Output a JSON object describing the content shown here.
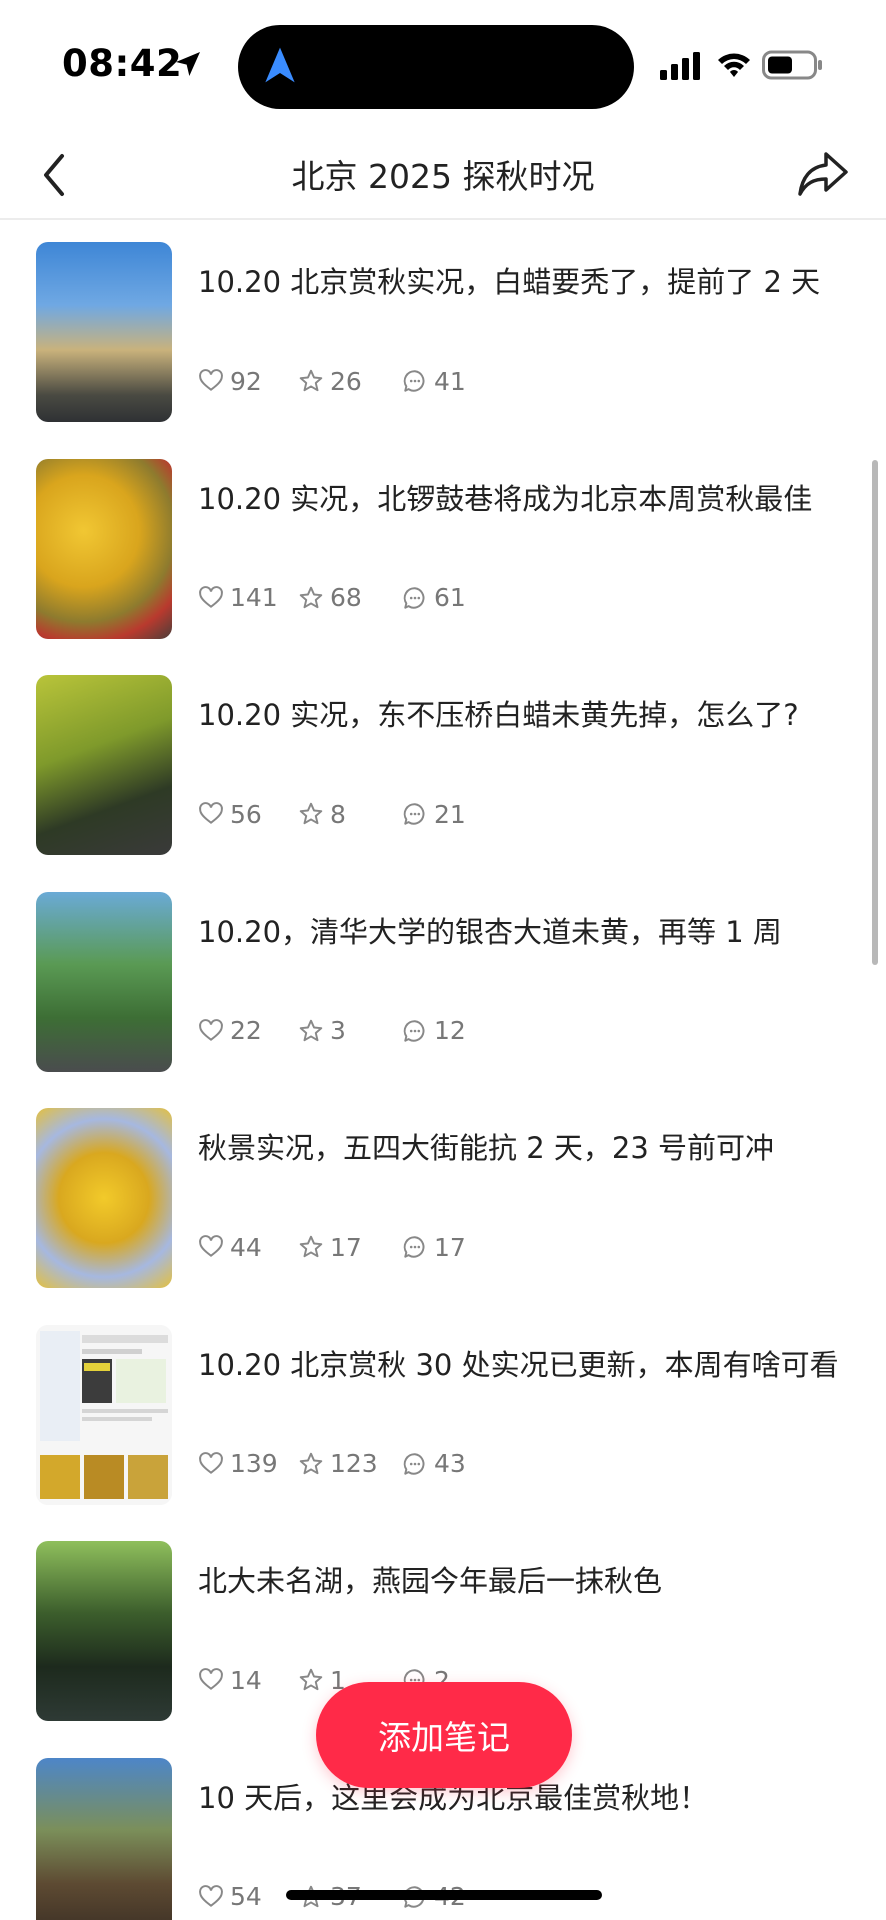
{
  "status_bar": {
    "time": "08:42"
  },
  "nav": {
    "title": "北京 2025 探秋时况"
  },
  "notes": [
    {
      "title": "10.20 北京赏秋实况，白蜡要秃了，提前了 2 天",
      "likes": "92",
      "stars": "26",
      "comments": "41"
    },
    {
      "title": "10.20 实况，北锣鼓巷将成为北京本周赏秋最佳",
      "likes": "141",
      "stars": "68",
      "comments": "61"
    },
    {
      "title": "10.20 实况，东不压桥白蜡未黄先掉，怎么了?",
      "likes": "56",
      "stars": "8",
      "comments": "21"
    },
    {
      "title": "10.20，清华大学的银杏大道未黄，再等 1 周",
      "likes": "22",
      "stars": "3",
      "comments": "12"
    },
    {
      "title": "秋景实况，五四大街能抗 2 天，23 号前可冲",
      "likes": "44",
      "stars": "17",
      "comments": "17"
    },
    {
      "title": "10.20 北京赏秋 30 处实况已更新，本周有啥可看",
      "likes": "139",
      "stars": "123",
      "comments": "43"
    },
    {
      "title": "北大未名湖，燕园今年最后一抹秋色",
      "likes": "14",
      "stars": "1",
      "comments": "2"
    },
    {
      "title": "10 天后，这里会成为北京最佳赏秋地！",
      "likes": "54",
      "stars": "37",
      "comments": "42"
    }
  ],
  "fab": {
    "label": "添加笔记"
  },
  "colors": {
    "accent": "#ff2a48",
    "text": "#222222",
    "meta": "#777777"
  },
  "icons": {
    "back": "chevron-left-icon",
    "share": "share-arrow-icon",
    "like": "heart-icon",
    "star": "star-icon",
    "comment": "comment-icon"
  }
}
